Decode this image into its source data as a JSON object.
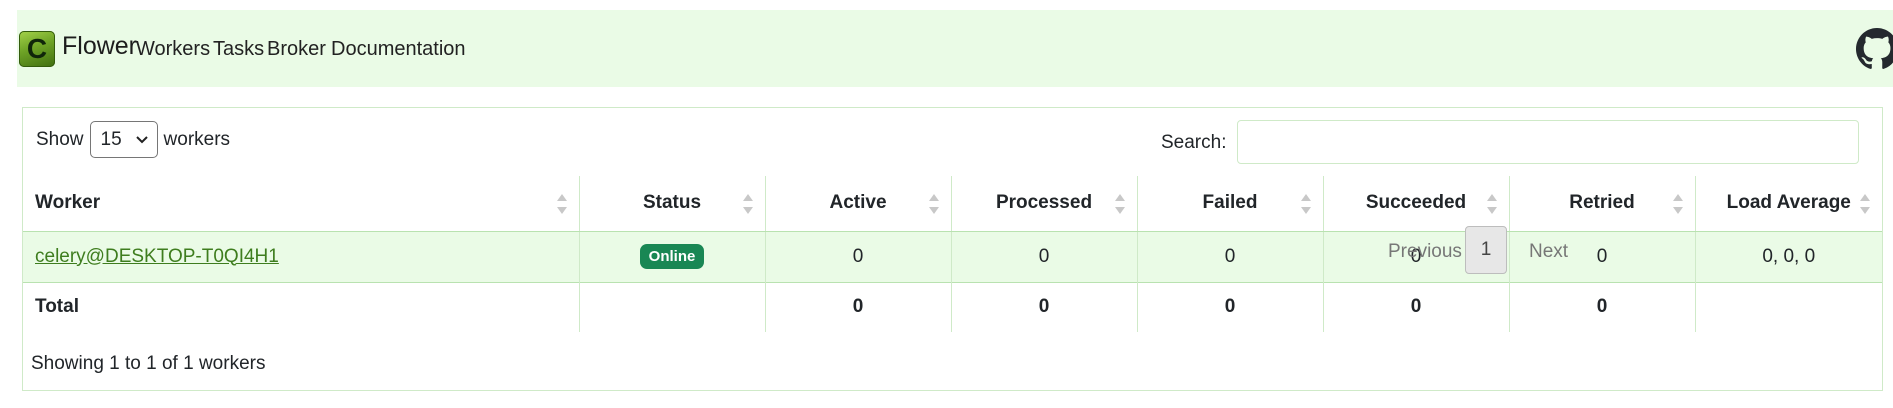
{
  "nav": {
    "logo_letter": "C",
    "brand": "Flower",
    "links": [
      "Workers",
      "Tasks",
      "Broker",
      "Documentation"
    ]
  },
  "table_controls": {
    "show_label": "Show",
    "page_size": "15",
    "entity_label": "workers",
    "search_label": "Search:",
    "search_value": ""
  },
  "columns": [
    "Worker",
    "Status",
    "Active",
    "Processed",
    "Failed",
    "Succeeded",
    "Retried",
    "Load Average"
  ],
  "rows": [
    {
      "worker": "celery@DESKTOP-T0QI4H1",
      "status": "Online",
      "active": "0",
      "processed": "0",
      "failed": "0",
      "succeeded": "0",
      "retried": "0",
      "load_average": "0, 0, 0"
    }
  ],
  "total": {
    "label": "Total",
    "active": "0",
    "processed": "0",
    "failed": "0",
    "succeeded": "0",
    "retried": "0"
  },
  "footer": {
    "info": "Showing 1 to 1 of 1 workers",
    "previous": "Previous",
    "current_page": "1",
    "next": "Next"
  },
  "colors": {
    "navbar_bg": "#eafbe6",
    "link": "#3e7d1e",
    "online_badge": "#198754"
  }
}
